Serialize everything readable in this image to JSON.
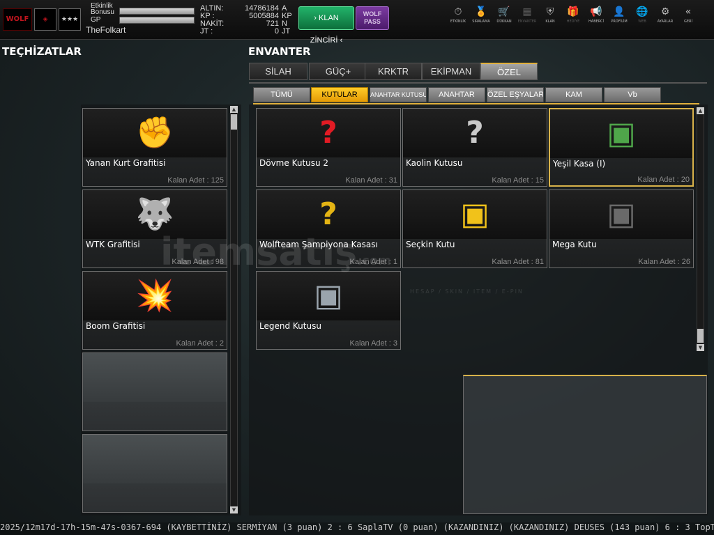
{
  "topbar": {
    "logo_text": "WOLF",
    "badge_stars": "★★★",
    "labels": {
      "etkinlik": "Etkinlik",
      "bonusu": "Bonusu",
      "gp": "GP"
    },
    "username": "TheFolkart",
    "currencies": [
      {
        "label": "ALTIN:",
        "value": "14786184",
        "unit": "A"
      },
      {
        "label": "KP :",
        "value": "5005884",
        "unit": "KP"
      },
      {
        "label": "NAKİT:",
        "value": "721",
        "unit": "N"
      },
      {
        "label": "JT :",
        "value": "0",
        "unit": "JT"
      }
    ],
    "klan_button": "KLAN ZİNCİRİ",
    "wolf_pass": {
      "line1": "WOLF",
      "line2": "PASS"
    },
    "nav": [
      {
        "label": "ETKİNLİK",
        "icon": "stopwatch-icon",
        "glyph": "⏱",
        "enabled": true
      },
      {
        "label": "SIRALAMA",
        "icon": "medal-icon",
        "glyph": "🏅",
        "enabled": true
      },
      {
        "label": "DÜKKAN",
        "icon": "cart-icon",
        "glyph": "🛒",
        "enabled": true
      },
      {
        "label": "ENVANTER",
        "icon": "inventory-icon",
        "glyph": "▦",
        "enabled": false
      },
      {
        "label": "KLAN",
        "icon": "shield-icon",
        "glyph": "⛨",
        "enabled": true
      },
      {
        "label": "HEDİYE",
        "icon": "gift-icon",
        "glyph": "🎁",
        "enabled": false
      },
      {
        "label": "HABERCİ",
        "icon": "megaphone-icon",
        "glyph": "📢",
        "enabled": true
      },
      {
        "label": "PROFİLİM",
        "icon": "profile-icon",
        "glyph": "👤",
        "enabled": true
      },
      {
        "label": "WEB",
        "icon": "globe-icon",
        "glyph": "🌐",
        "enabled": false
      },
      {
        "label": "AYARLAR",
        "icon": "gear-icon",
        "glyph": "⚙",
        "enabled": true
      },
      {
        "label": "GERİ",
        "icon": "back-icon",
        "glyph": "«",
        "enabled": true
      }
    ]
  },
  "left": {
    "title": "TEÇHİZATLAR",
    "items": [
      {
        "name": "Yanan Kurt Grafitisi",
        "count": "Kalan Adet : 125",
        "icon": "flaming-wolf-graffiti-icon"
      },
      {
        "name": "WTK Grafitisi",
        "count": "Kalan Adet : 98",
        "icon": "wtk-wolf-graffiti-icon"
      },
      {
        "name": "Boom Grafitisi",
        "count": "Kalan Adet : 2",
        "icon": "boom-graffiti-icon"
      }
    ]
  },
  "envanter": {
    "title": "ENVANTER",
    "tabs": [
      "SİLAH",
      "GÜÇ+",
      "KRKTR",
      "EKİPMAN",
      "ÖZEL"
    ],
    "active_tab": 4,
    "subtabs": [
      "TÜMÜ",
      "KUTULAR",
      "ANAHTAR KUTUSU",
      "ANAHTAR",
      "ÖZEL EŞYALAR",
      "KAM",
      "Vb"
    ],
    "active_subtab": 1,
    "items": [
      {
        "name": "Dövme Kutusu 2",
        "count": "Kalan Adet : 31",
        "icon": "red-mystery-box-icon"
      },
      {
        "name": "Kaolin Kutusu",
        "count": "Kalan Adet : 15",
        "icon": "silver-mystery-box-icon"
      },
      {
        "name": "Yeşil Kasa (I)",
        "count": "Kalan Adet : 20",
        "icon": "green-crate-icon"
      },
      {
        "name": "Wolfteam Şampiyona Kasası",
        "count": "Kalan Adet : 1",
        "icon": "gold-mystery-crate-icon"
      },
      {
        "name": "Seçkin Kutu",
        "count": "Kalan Adet : 81",
        "icon": "gold-crate-icon"
      },
      {
        "name": "Mega Kutu",
        "count": "Kalan Adet : 26",
        "icon": "black-crate-icon"
      },
      {
        "name": "Legend Kutusu",
        "count": "Kalan Adet : 3",
        "icon": "legend-crate-icon"
      }
    ],
    "selected_index": 2
  },
  "colors": {
    "accent": "#ffc21f",
    "selected_border": "#d8b24a",
    "klan_green": "#1a9a57",
    "wolfpass_purple": "#6a2b8c"
  },
  "ticker": "2025/12m17d-17h-15m-47s-0367-694   (KAYBETTİNİZ) SERMİYAN (3 puan) 2 : 6 SaplaTV (0 puan) (KAZANDINIZ)          (KAZANDINIZ) DEUSES (143 puan) 6 : 3 TopT",
  "watermark": {
    "main": "itemsatış",
    "sub": "HESAP / SKIN / ITEM / E-PIN",
    "com": ".com"
  }
}
